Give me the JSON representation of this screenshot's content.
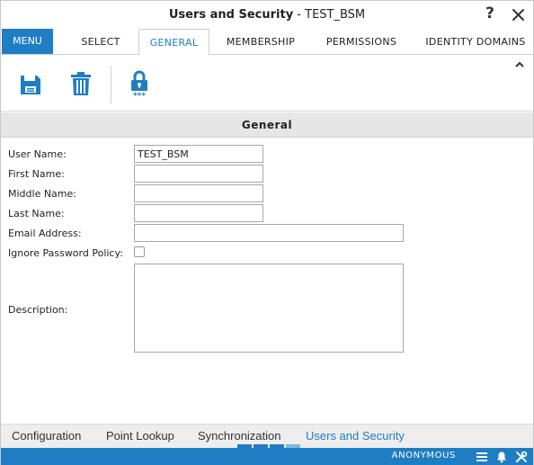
{
  "window": {
    "title_app": "Users and Security",
    "title_sep": " - ",
    "title_object": "TEST_BSM",
    "help_label": "?"
  },
  "tabs": {
    "menu": "MENU",
    "items": [
      {
        "label": "SELECT"
      },
      {
        "label": "GENERAL",
        "active": true
      },
      {
        "label": "MEMBERSHIP"
      },
      {
        "label": "PERMISSIONS"
      },
      {
        "label": "IDENTITY DOMAINS"
      }
    ]
  },
  "toolbar": {
    "icons": [
      "save-icon",
      "delete-icon",
      "password-lock-icon"
    ]
  },
  "section": {
    "title": "General"
  },
  "form": {
    "user_name": {
      "label": "User Name:",
      "value": "TEST_BSM"
    },
    "first_name": {
      "label": "First Name:",
      "value": ""
    },
    "middle_name": {
      "label": "Middle Name:",
      "value": ""
    },
    "last_name": {
      "label": "Last Name:",
      "value": ""
    },
    "email": {
      "label": "Email Address:",
      "value": ""
    },
    "ignore_password_policy": {
      "label": "Ignore Password Policy:",
      "checked": false
    },
    "description": {
      "label": "Description:",
      "value": ""
    }
  },
  "bottom_tabs": {
    "items": [
      {
        "label": "Configuration"
      },
      {
        "label": "Point Lookup"
      },
      {
        "label": "Synchronization"
      },
      {
        "label": "Users and Security",
        "active": true
      }
    ]
  },
  "status": {
    "user": "ANONYMOUS",
    "icons": [
      "list-icon",
      "bell-icon",
      "tools-icon"
    ]
  },
  "colors": {
    "accent": "#1f7dc4",
    "section_header_bg": "#e6e6e6",
    "bottom_tabs_bg": "#eeeeee"
  }
}
